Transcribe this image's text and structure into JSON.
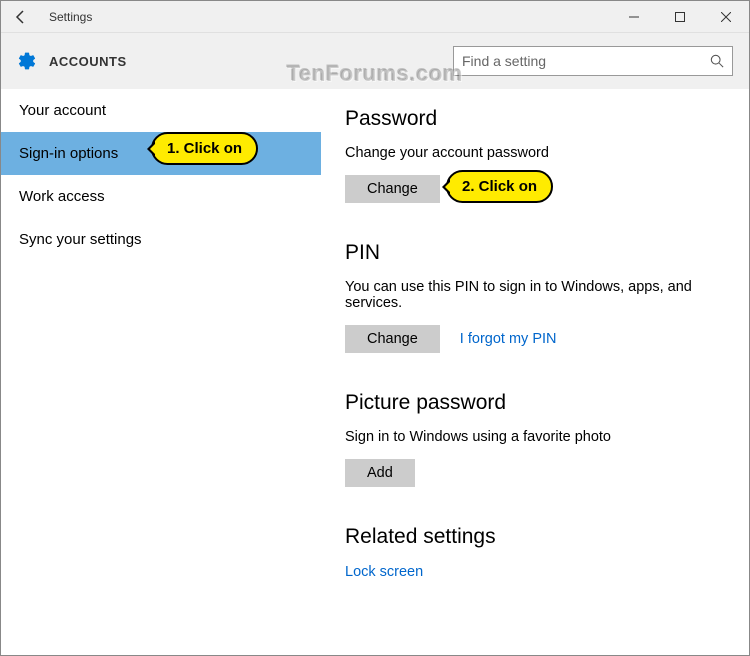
{
  "titlebar": {
    "title": "Settings"
  },
  "header": {
    "title": "ACCOUNTS",
    "search_placeholder": "Find a setting"
  },
  "sidebar": {
    "items": [
      {
        "label": "Your account"
      },
      {
        "label": "Sign-in options"
      },
      {
        "label": "Work access"
      },
      {
        "label": "Sync your settings"
      }
    ]
  },
  "main": {
    "password": {
      "heading": "Password",
      "desc": "Change your account password",
      "button": "Change"
    },
    "pin": {
      "heading": "PIN",
      "desc": "You can use this PIN to sign in to Windows, apps, and services.",
      "button": "Change",
      "link": "I forgot my PIN"
    },
    "picture": {
      "heading": "Picture password",
      "desc": "Sign in to Windows using a favorite photo",
      "button": "Add"
    },
    "related": {
      "heading": "Related settings",
      "link": "Lock screen"
    }
  },
  "callouts": {
    "c1": "1. Click on",
    "c2": "2. Click on"
  },
  "watermark": "TenForums.com"
}
